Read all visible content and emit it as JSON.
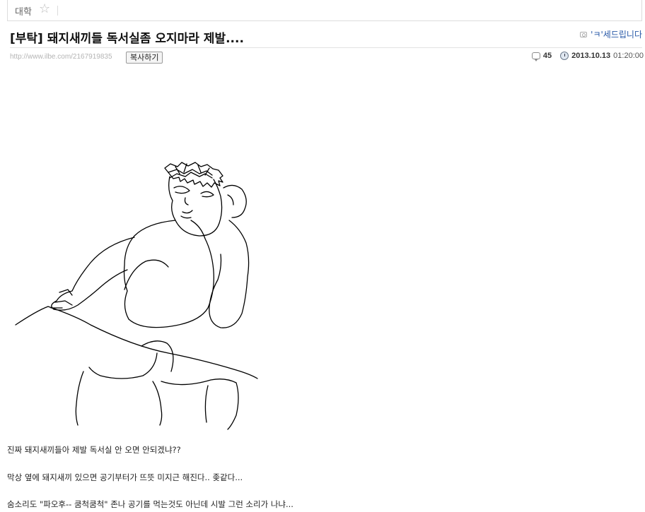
{
  "board": {
    "name": "대학"
  },
  "post": {
    "title": "[부탁] 돼지새끼들 독서실좀 오지마라 제발....",
    "author": "'ㅋ'세드립니다",
    "url": "http://www.ilbe.com/2167919835",
    "copy_label": "복사하기",
    "comment_count": "45",
    "date": "2013.10.13",
    "time": "01:20:00",
    "body_lines": [
      "진짜 돼지새끼들아 제발 독서실 안 오면 안되겠냐??",
      "막상 옆에 돼지새끼 있으면 공기부터가 뜨뜻 미지근 해진다.. 좆같다...",
      "숨소리도 \"파오후-- 쿰척쿰척\" 존나 공기를 먹는것도 아닌데 시발 그런 소리가 나냐..."
    ]
  },
  "icons": {
    "favorite": "star-icon",
    "author": "profile-icon",
    "comments": "comment-icon",
    "date": "clock-icon"
  },
  "colors": {
    "author_link": "#2a5aa8",
    "url_text": "#b4b4b4"
  }
}
